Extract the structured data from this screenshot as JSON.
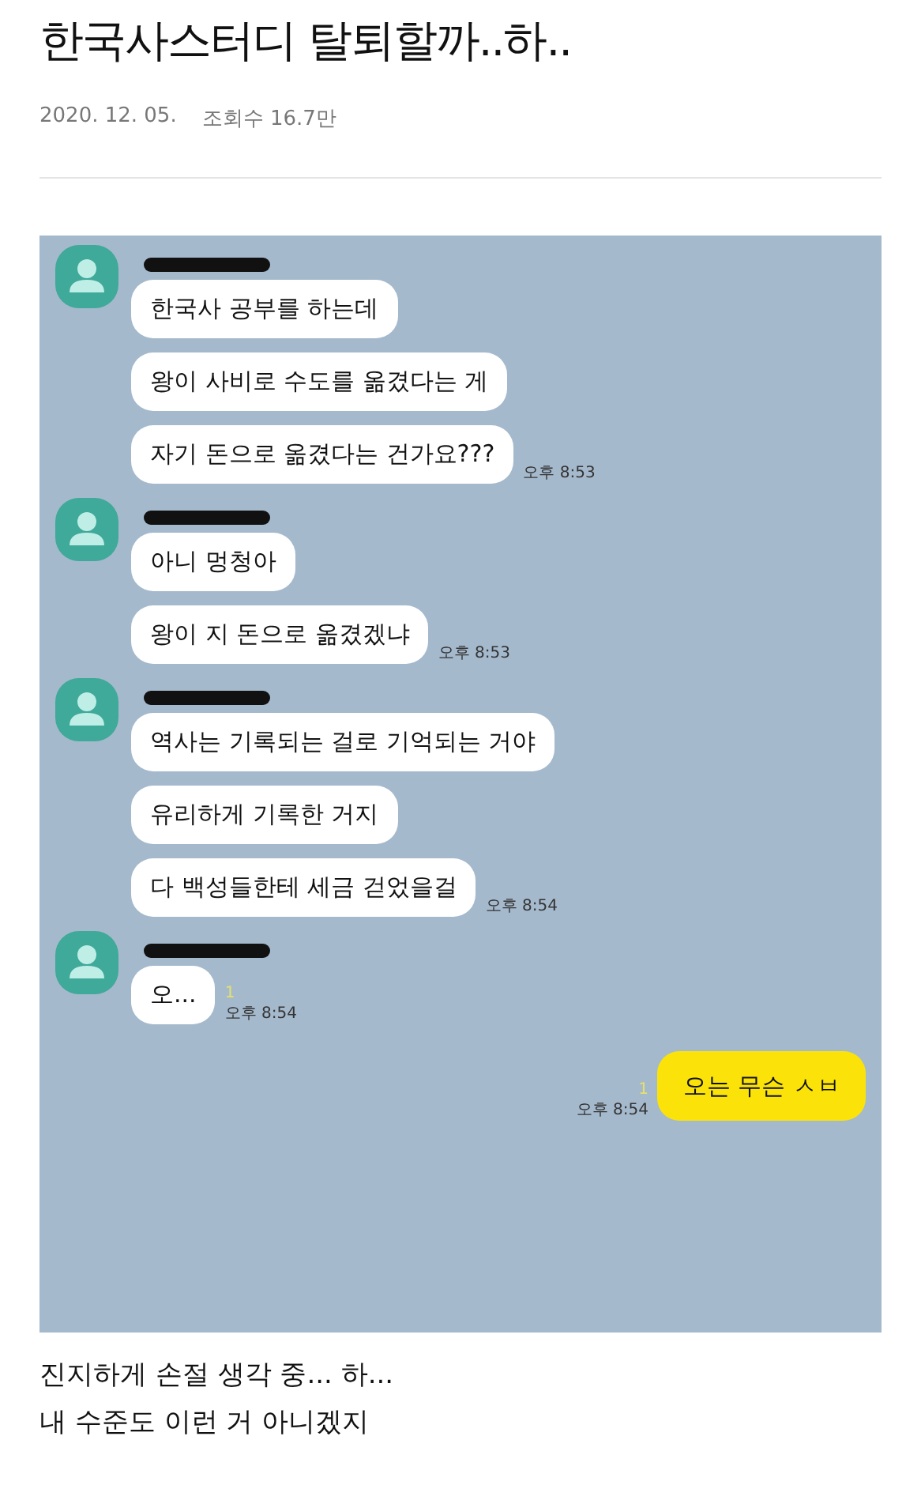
{
  "post": {
    "title": "한국사스터디 탈퇴할까..하..",
    "date": "2020. 12. 05.",
    "views": "조회수 16.7만"
  },
  "chat": {
    "groups": [
      {
        "kind": "received",
        "bubbles": [
          "한국사 공부를 하는데",
          "왕이 사비로 수도를 옮겼다는 게",
          "자기 돈으로 옮겼다는 건가요???"
        ],
        "time": "오후 8:53"
      },
      {
        "kind": "received",
        "bubbles": [
          "아니 멍청아",
          "왕이 지 돈으로 옮겼겠냐"
        ],
        "time": "오후 8:53"
      },
      {
        "kind": "received",
        "bubbles": [
          "역사는 기록되는 걸로 기억되는 거야",
          "유리하게 기록한 거지",
          "다 백성들한테 세금 걷었을걸"
        ],
        "time": "오후 8:54"
      },
      {
        "kind": "received",
        "bubbles": [
          "오..."
        ],
        "unread": "1",
        "time": "오후 8:54"
      },
      {
        "kind": "sent",
        "bubbles": [
          "오는 무슨 ㅅㅂ"
        ],
        "unread": "1",
        "time": "오후 8:54"
      }
    ]
  },
  "caption": [
    "진지하게 손절 생각 중... 하...",
    "내 수준도 이런 거 아니겠지"
  ]
}
